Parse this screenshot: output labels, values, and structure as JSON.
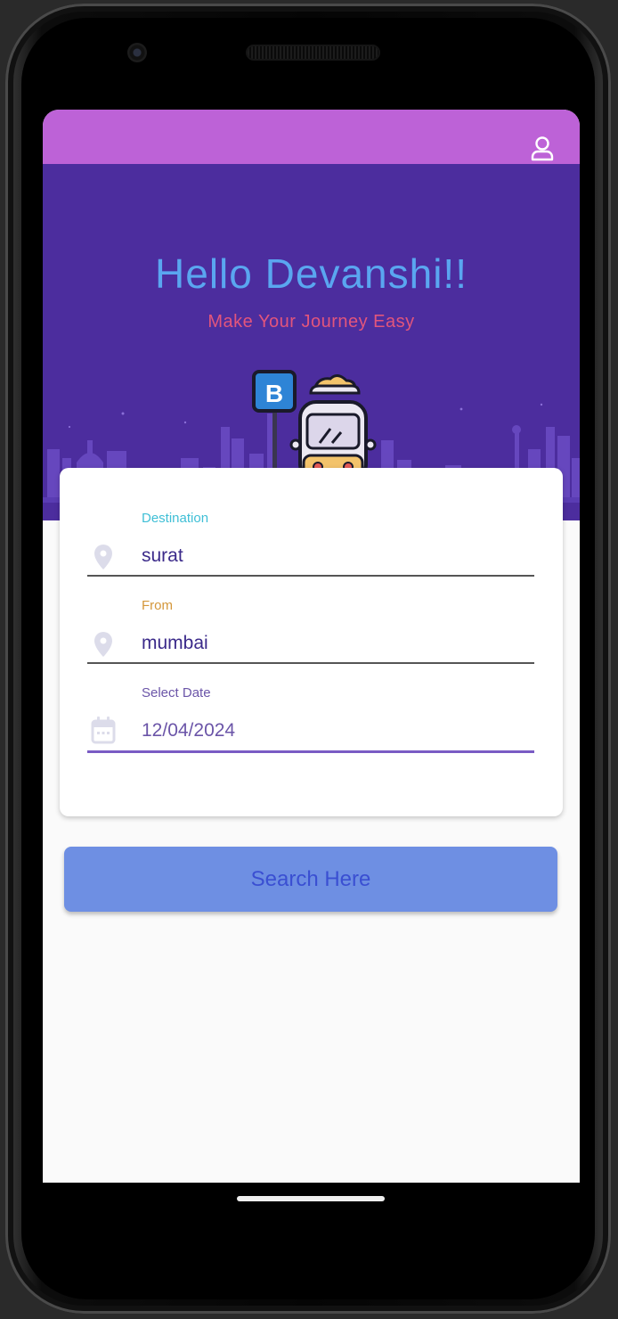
{
  "header": {
    "profile_icon": "person-outline-icon",
    "bar_color": "#bd62d7"
  },
  "hero": {
    "greeting": "Hello Devanshi!!",
    "tagline": "Make Your Journey Easy",
    "greeting_color": "#5aa6f0",
    "tagline_color": "#e2557c",
    "background": "#4c2d9e",
    "illustration": "bus-stop-icon",
    "bus_stop_sign": "B"
  },
  "form": {
    "destination": {
      "label": "Destination",
      "value": "surat",
      "icon": "location-pin-icon",
      "label_color": "#3fbfd6"
    },
    "from": {
      "label": "From",
      "value": "mumbai",
      "icon": "location-pin-icon",
      "label_color": "#d4973a"
    },
    "date": {
      "label": "Select Date",
      "value": "12/04/2024",
      "icon": "calendar-icon",
      "label_color": "#6b55a8"
    }
  },
  "search_button": {
    "label": "Search Here",
    "color": "#6e8fe3"
  }
}
